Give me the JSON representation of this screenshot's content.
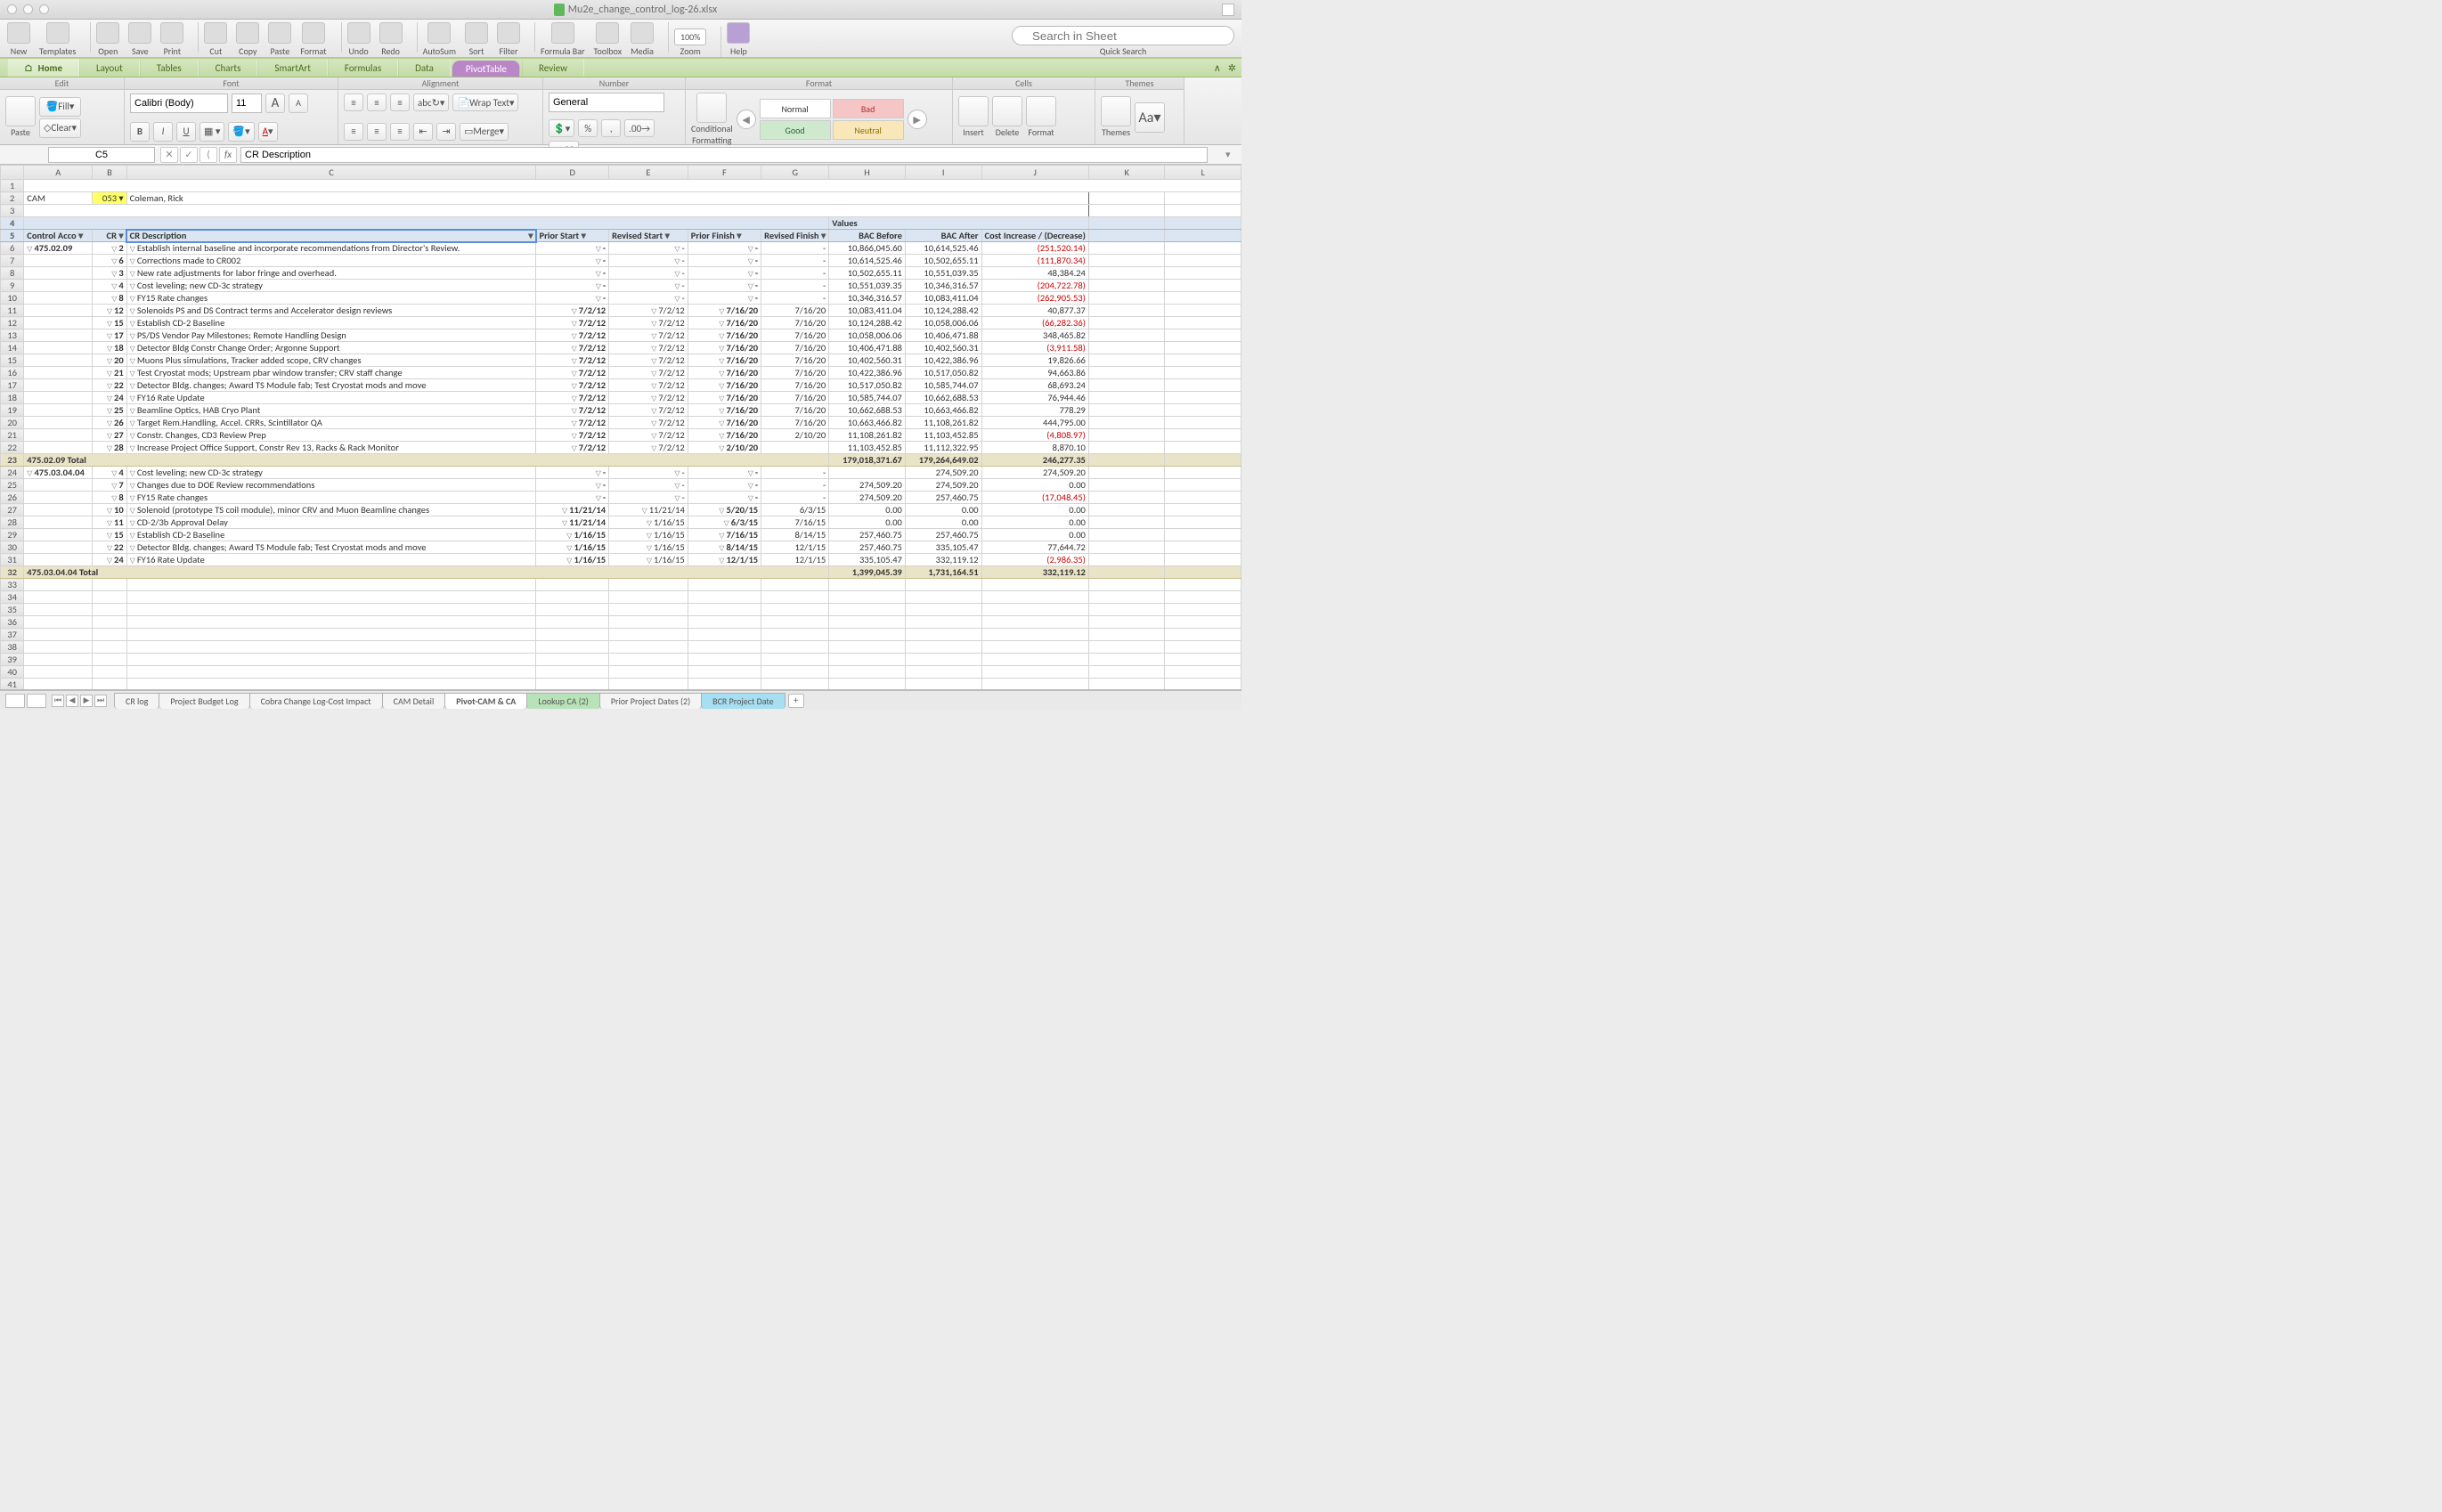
{
  "window": {
    "filename": "Mu2e_change_control_log-26.xlsx"
  },
  "toolbar": {
    "items": [
      "New",
      "Templates",
      "Open",
      "Save",
      "Print",
      "Cut",
      "Copy",
      "Paste",
      "Format",
      "Undo",
      "Redo",
      "AutoSum",
      "Sort",
      "Filter",
      "Formula Bar",
      "Toolbox",
      "Media"
    ],
    "zoom": "100%",
    "zoom_label": "Zoom",
    "help": "Help",
    "search_placeholder": "Search in Sheet",
    "search_label": "Quick Search"
  },
  "ribbon_tabs": [
    "Home",
    "Layout",
    "Tables",
    "Charts",
    "SmartArt",
    "Formulas",
    "Data",
    "PivotTable",
    "Review"
  ],
  "ribbon": {
    "edit": {
      "label": "Edit",
      "paste": "Paste",
      "fill": "Fill",
      "clear": "Clear"
    },
    "font": {
      "label": "Font",
      "name": "Calibri (Body)",
      "size": "11"
    },
    "alignment": {
      "label": "Alignment",
      "wrap": "Wrap Text",
      "merge": "Merge"
    },
    "number": {
      "label": "Number",
      "format": "General"
    },
    "format": {
      "label": "Format",
      "cond": "Conditional\nFormatting",
      "normal": "Normal",
      "bad": "Bad",
      "good": "Good",
      "neutral": "Neutral"
    },
    "cells": {
      "label": "Cells",
      "insert": "Insert",
      "delete": "Delete",
      "format": "Format"
    },
    "themes": {
      "label": "Themes",
      "themes": "Themes",
      "aa": "Aa"
    }
  },
  "formula_bar": {
    "namebox": "C5",
    "value": "CR Description"
  },
  "columns": [
    "A",
    "B",
    "C",
    "D",
    "E",
    "F",
    "G",
    "H",
    "I",
    "J",
    "K",
    "L"
  ],
  "topcells": {
    "A2": "CAM",
    "B2": "053",
    "C2": "Coleman, Rick",
    "H4": "Values"
  },
  "headers5": {
    "A": "Control Acco",
    "B": "CR",
    "C": "CR Description",
    "D": "Prior Start",
    "E": "Revised Start",
    "F": "Prior Finish",
    "G": "Revised Finish",
    "H": "BAC Before",
    "I": "BAC After",
    "J": "Cost Increase / (Decrease)"
  },
  "rows": [
    {
      "r": 6,
      "acct": "475.02.09",
      "cr": "2",
      "desc": "Establish internal baseline and incorporate recommendations from Director's Review.",
      "ps": "-",
      "rs": "-",
      "pf": "-",
      "rf": "-",
      "bb": "10,866,045.60",
      "ba": "10,614,525.46",
      "ci": "(251,520.14)",
      "neg": true
    },
    {
      "r": 7,
      "cr": "6",
      "desc": "Corrections made to CR002",
      "ps": "-",
      "rs": "-",
      "pf": "-",
      "rf": "-",
      "bb": "10,614,525.46",
      "ba": "10,502,655.11",
      "ci": "(111,870.34)",
      "neg": true
    },
    {
      "r": 8,
      "cr": "3",
      "desc": "New rate adjustments for labor fringe and overhead.",
      "ps": "-",
      "rs": "-",
      "pf": "-",
      "rf": "-",
      "bb": "10,502,655.11",
      "ba": "10,551,039.35",
      "ci": "48,384.24"
    },
    {
      "r": 9,
      "cr": "4",
      "desc": "Cost leveling; new CD-3c strategy",
      "ps": "-",
      "rs": "-",
      "pf": "-",
      "rf": "-",
      "bb": "10,551,039.35",
      "ba": "10,346,316.57",
      "ci": "(204,722.78)",
      "neg": true
    },
    {
      "r": 10,
      "cr": "8",
      "desc": "FY15 Rate changes",
      "ps": "-",
      "rs": "-",
      "pf": "-",
      "rf": "-",
      "bb": "10,346,316.57",
      "ba": "10,083,411.04",
      "ci": "(262,905.53)",
      "neg": true
    },
    {
      "r": 11,
      "cr": "12",
      "desc": "Solenoids PS and DS Contract terms and Accelerator design reviews",
      "ps": "7/2/12",
      "rs": "7/2/12",
      "pf": "7/16/20",
      "rf": "7/16/20",
      "bb": "10,083,411.04",
      "ba": "10,124,288.42",
      "ci": "40,877.37"
    },
    {
      "r": 12,
      "cr": "15",
      "desc": "Establish CD-2 Baseline",
      "ps": "7/2/12",
      "rs": "7/2/12",
      "pf": "7/16/20",
      "rf": "7/16/20",
      "bb": "10,124,288.42",
      "ba": "10,058,006.06",
      "ci": "(66,282.36)",
      "neg": true
    },
    {
      "r": 13,
      "cr": "17",
      "desc": "PS/DS Vendor Pay Milestones; Remote Handling Design",
      "ps": "7/2/12",
      "rs": "7/2/12",
      "pf": "7/16/20",
      "rf": "7/16/20",
      "bb": "10,058,006.06",
      "ba": "10,406,471.88",
      "ci": "348,465.82"
    },
    {
      "r": 14,
      "cr": "18",
      "desc": "Detector Bldg Constr Change Order; Argonne Support",
      "ps": "7/2/12",
      "rs": "7/2/12",
      "pf": "7/16/20",
      "rf": "7/16/20",
      "bb": "10,406,471.88",
      "ba": "10,402,560.31",
      "ci": "(3,911.58)",
      "neg": true
    },
    {
      "r": 15,
      "cr": "20",
      "desc": "Muons Plus simulations, Tracker added scope, CRV changes",
      "ps": "7/2/12",
      "rs": "7/2/12",
      "pf": "7/16/20",
      "rf": "7/16/20",
      "bb": "10,402,560.31",
      "ba": "10,422,386.96",
      "ci": "19,826.66"
    },
    {
      "r": 16,
      "cr": "21",
      "desc": "Test Cryostat mods; Upstream pbar window transfer; CRV staff change",
      "ps": "7/2/12",
      "rs": "7/2/12",
      "pf": "7/16/20",
      "rf": "7/16/20",
      "bb": "10,422,386.96",
      "ba": "10,517,050.82",
      "ci": "94,663.86"
    },
    {
      "r": 17,
      "cr": "22",
      "desc": "Detector Bldg. changes; Award TS Module fab; Test Cryostat mods and move",
      "ps": "7/2/12",
      "rs": "7/2/12",
      "pf": "7/16/20",
      "rf": "7/16/20",
      "bb": "10,517,050.82",
      "ba": "10,585,744.07",
      "ci": "68,693.24"
    },
    {
      "r": 18,
      "cr": "24",
      "desc": "FY16 Rate Update",
      "ps": "7/2/12",
      "rs": "7/2/12",
      "pf": "7/16/20",
      "rf": "7/16/20",
      "bb": "10,585,744.07",
      "ba": "10,662,688.53",
      "ci": "76,944.46"
    },
    {
      "r": 19,
      "cr": "25",
      "desc": "Beamline Optics, HAB Cryo Plant",
      "ps": "7/2/12",
      "rs": "7/2/12",
      "pf": "7/16/20",
      "rf": "7/16/20",
      "bb": "10,662,688.53",
      "ba": "10,663,466.82",
      "ci": "778.29"
    },
    {
      "r": 20,
      "cr": "26",
      "desc": "Target Rem.Handling, Accel. CRRs, Scintillator QA",
      "ps": "7/2/12",
      "rs": "7/2/12",
      "pf": "7/16/20",
      "rf": "7/16/20",
      "bb": "10,663,466.82",
      "ba": "11,108,261.82",
      "ci": "444,795.00"
    },
    {
      "r": 21,
      "cr": "27",
      "desc": "Constr. Changes, CD3 Review Prep",
      "ps": "7/2/12",
      "rs": "7/2/12",
      "pf": "7/16/20",
      "rf": "2/10/20",
      "bb": "11,108,261.82",
      "ba": "11,103,452.85",
      "ci": "(4,808.97)",
      "neg": true
    },
    {
      "r": 22,
      "cr": "28",
      "desc": "Increase Project Office Support, Constr Rev 13, Racks & Rack Monitor",
      "ps": "7/2/12",
      "rs": "7/2/12",
      "pf": "2/10/20",
      "rf": "",
      "bb": "11,103,452.85",
      "ba": "11,112,322.95",
      "ci": "8,870.10"
    },
    {
      "r": 23,
      "total": true,
      "label": "475.02.09 Total",
      "bb": "179,018,371.67",
      "ba": "179,264,649.02",
      "ci": "246,277.35"
    },
    {
      "r": 24,
      "acct": "475.03.04.04",
      "cr": "4",
      "desc": "Cost leveling; new CD-3c strategy",
      "ps": "-",
      "rs": "-",
      "pf": "-",
      "rf": "-",
      "bb": "",
      "ba": "274,509.20",
      "ci": "274,509.20"
    },
    {
      "r": 25,
      "cr": "7",
      "desc": "Changes due to DOE Review recommendations",
      "ps": "-",
      "rs": "-",
      "pf": "-",
      "rf": "-",
      "bb": "274,509.20",
      "ba": "274,509.20",
      "ci": "0.00"
    },
    {
      "r": 26,
      "cr": "8",
      "desc": "FY15 Rate changes",
      "ps": "-",
      "rs": "-",
      "pf": "-",
      "rf": "-",
      "bb": "274,509.20",
      "ba": "257,460.75",
      "ci": "(17,048.45)",
      "neg": true
    },
    {
      "r": 27,
      "cr": "10",
      "desc": "Solenoid (prototype TS coil module), minor CRV and Muon Beamline changes",
      "ps": "11/21/14",
      "rs": "11/21/14",
      "pf": "5/20/15",
      "rf": "6/3/15",
      "bb": "0.00",
      "ba": "0.00",
      "ci": "0.00"
    },
    {
      "r": 28,
      "cr": "11",
      "desc": "CD-2/3b Approval Delay",
      "ps": "11/21/14",
      "rs": "1/16/15",
      "pf": "6/3/15",
      "rf": "7/16/15",
      "bb": "0.00",
      "ba": "0.00",
      "ci": "0.00"
    },
    {
      "r": 29,
      "cr": "15",
      "desc": "Establish CD-2 Baseline",
      "ps": "1/16/15",
      "rs": "1/16/15",
      "pf": "7/16/15",
      "rf": "8/14/15",
      "bb": "257,460.75",
      "ba": "257,460.75",
      "ci": "0.00"
    },
    {
      "r": 30,
      "cr": "22",
      "desc": "Detector Bldg. changes; Award TS Module fab; Test Cryostat mods and move",
      "ps": "1/16/15",
      "rs": "1/16/15",
      "pf": "8/14/15",
      "rf": "12/1/15",
      "bb": "257,460.75",
      "ba": "335,105.47",
      "ci": "77,644.72"
    },
    {
      "r": 31,
      "cr": "24",
      "desc": "FY16 Rate Update",
      "ps": "1/16/15",
      "rs": "1/16/15",
      "pf": "12/1/15",
      "rf": "12/1/15",
      "bb": "335,105.47",
      "ba": "332,119.12",
      "ci": "(2,986.35)",
      "neg": true
    },
    {
      "r": 32,
      "total": true,
      "label": "475.03.04.04 Total",
      "bb": "1,399,045.39",
      "ba": "1,731,164.51",
      "ci": "332,119.12"
    }
  ],
  "empty_rows": [
    33,
    34,
    35,
    36,
    37,
    38,
    39,
    40,
    41
  ],
  "sheet_tabs": [
    {
      "label": "CR log"
    },
    {
      "label": "Project Budget Log"
    },
    {
      "label": "Cobra Change Log-Cost Impact"
    },
    {
      "label": "CAM Detail"
    },
    {
      "label": "Pivot-CAM & CA",
      "active": true
    },
    {
      "label": "Lookup CA (2)",
      "class": "green"
    },
    {
      "label": "Prior Project Dates (2)"
    },
    {
      "label": "BCR Project Date",
      "class": "blue"
    }
  ]
}
